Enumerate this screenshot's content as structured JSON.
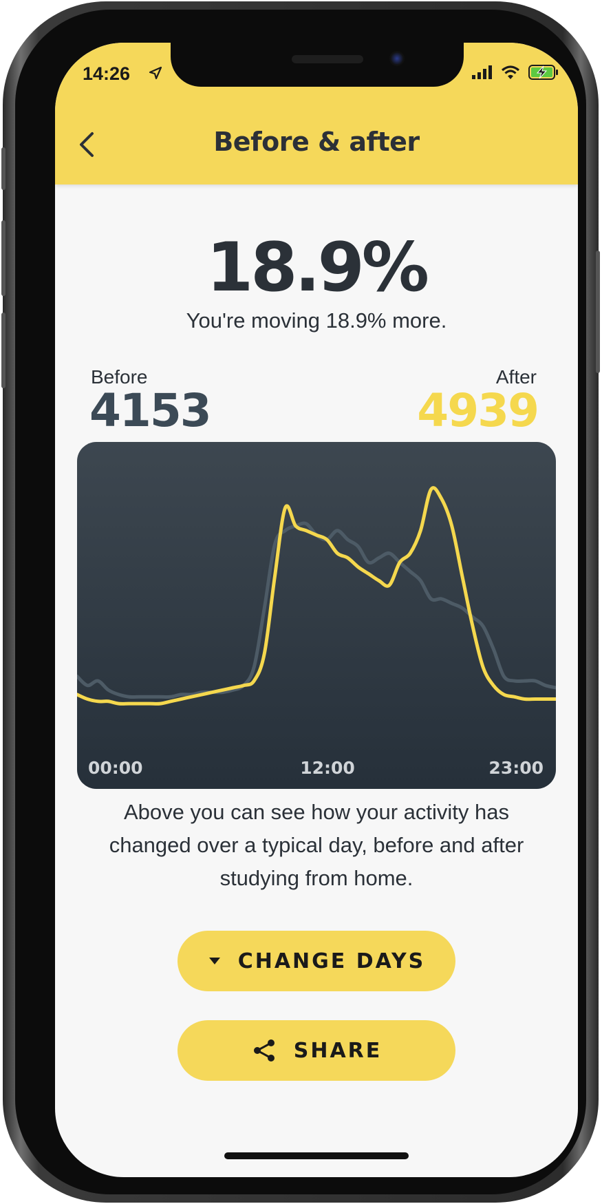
{
  "status_bar": {
    "time": "14:26"
  },
  "header": {
    "title": "Before & after"
  },
  "summary": {
    "percent": "18.9%",
    "subtitle": "You're moving 18.9% more."
  },
  "totals": {
    "before_label": "Before",
    "before_value": "4153",
    "after_label": "After",
    "after_value": "4939"
  },
  "chart_data": {
    "type": "line",
    "x_tick_labels": [
      "00:00",
      "12:00",
      "23:00"
    ],
    "x": [
      0.0,
      0.5,
      1.0,
      1.5,
      2.0,
      2.5,
      3.0,
      3.5,
      4.0,
      4.5,
      5.0,
      5.5,
      6.0,
      6.5,
      7.0,
      7.5,
      8.0,
      8.5,
      9.0,
      9.5,
      10.0,
      10.5,
      11.0,
      11.5,
      12.0,
      12.5,
      13.0,
      13.5,
      14.0,
      14.5,
      15.0,
      15.5,
      16.0,
      16.5,
      17.0,
      17.5,
      18.0,
      18.5,
      19.0,
      19.5,
      20.0,
      20.5,
      21.0,
      21.5,
      22.0,
      22.5,
      23.0
    ],
    "series": [
      {
        "color": "#4d5b66",
        "values": [
          18,
          14,
          16,
          12,
          10,
          9,
          9,
          9,
          9,
          9,
          10,
          10,
          11,
          11,
          11,
          12,
          14,
          22,
          48,
          76,
          82,
          84,
          85,
          80,
          78,
          82,
          78,
          75,
          68,
          70,
          72,
          68,
          64,
          60,
          52,
          52,
          50,
          48,
          44,
          40,
          30,
          18,
          16,
          16,
          16,
          14,
          13
        ]
      },
      {
        "color": "#f5d84e",
        "values": [
          10,
          8,
          7,
          7,
          6,
          6,
          6,
          6,
          6,
          7,
          8,
          9,
          10,
          11,
          12,
          13,
          14,
          16,
          28,
          62,
          92,
          84,
          82,
          80,
          78,
          72,
          70,
          66,
          63,
          60,
          58,
          68,
          72,
          82,
          100,
          96,
          84,
          62,
          40,
          22,
          14,
          10,
          9,
          8,
          8,
          8,
          8
        ]
      }
    ],
    "ylim": [
      0,
      110
    ]
  },
  "description": "Above you can see how your activity has changed over a typical day, before and after studying from home.",
  "buttons": {
    "change_days": "CHANGE DAYS",
    "share": "SHARE"
  },
  "colors": {
    "accent": "#f5d85a",
    "dark": "#2b3138"
  }
}
